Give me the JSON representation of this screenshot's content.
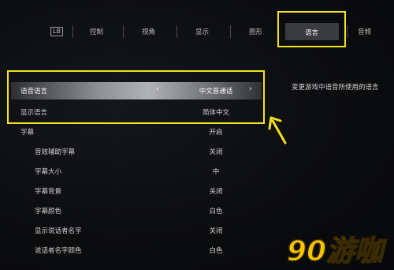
{
  "tabs": {
    "icon_label": "LB",
    "items": [
      {
        "label": "控制"
      },
      {
        "label": "视角"
      },
      {
        "label": "显示"
      },
      {
        "label": "图形"
      },
      {
        "label": "语言"
      },
      {
        "label": "音频"
      }
    ],
    "active_index": 4
  },
  "description": "变更游戏中语音所使用的语言",
  "settings": [
    {
      "label": "语音语言",
      "value": "中文普通话",
      "selected": true
    },
    {
      "label": "显示语言",
      "value": "简体中文"
    },
    {
      "label": "字幕",
      "value": "开启"
    },
    {
      "label": "音效辅助字幕",
      "value": "关闭"
    },
    {
      "label": "字幕大小",
      "value": "中"
    },
    {
      "label": "字幕背景",
      "value": "关闭"
    },
    {
      "label": "字幕颜色",
      "value": "白色"
    },
    {
      "label": "显示说话者名字",
      "value": "关闭"
    },
    {
      "label": "说话者名字颜色",
      "value": "白色"
    }
  ],
  "arrows": {
    "left": "‹",
    "right": "›"
  },
  "watermark": {
    "text": "90游咖"
  },
  "colors": {
    "highlight": "#f3e21d"
  }
}
